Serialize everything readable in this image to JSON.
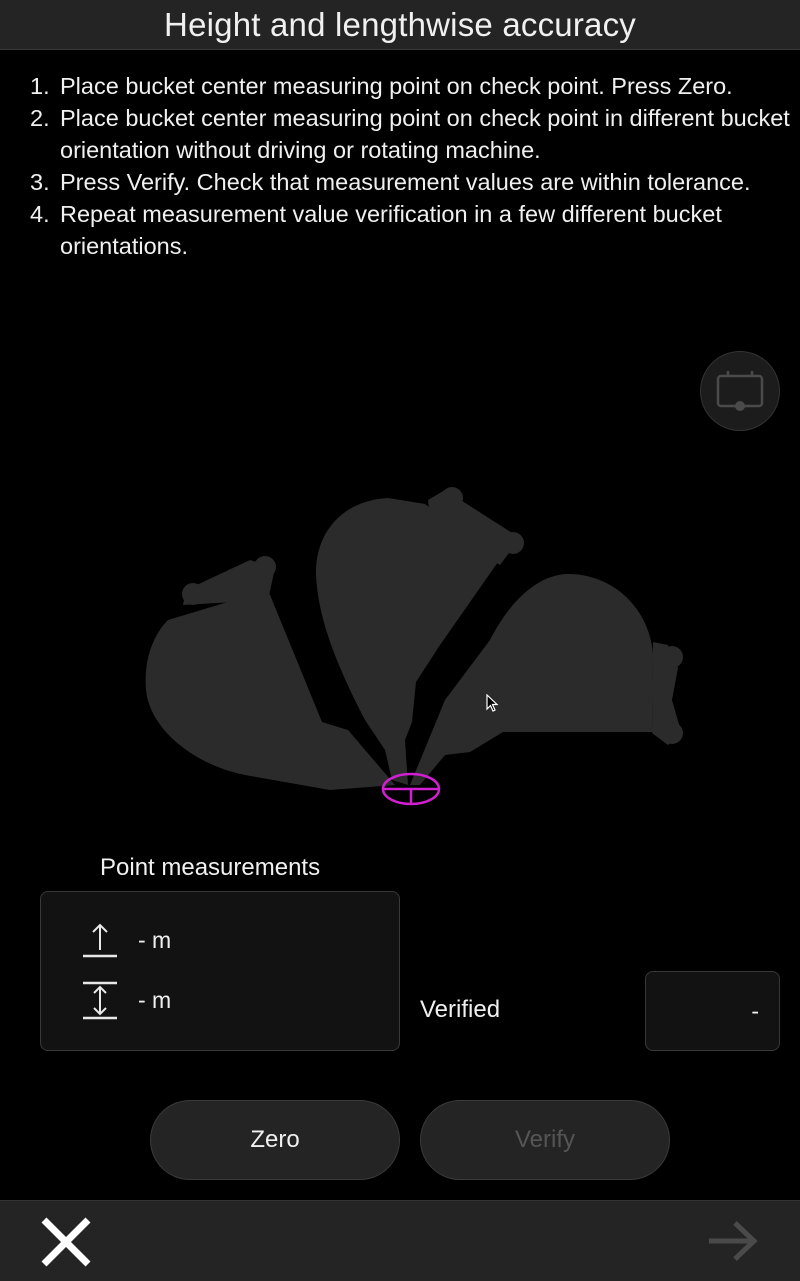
{
  "header": {
    "title": "Height and lengthwise accuracy"
  },
  "instructions": [
    {
      "num": "1.",
      "text": "Place bucket center measuring point on check point. Press Zero."
    },
    {
      "num": "2.",
      "text": "Place bucket center measuring point on check point in different bucket orientation without driving or rotating machine."
    },
    {
      "num": "3.",
      "text": "Press Verify. Check that measurement values are within tolerance."
    },
    {
      "num": "4.",
      "text": "Repeat measurement value verification in a few different bucket orientations."
    }
  ],
  "illustration": {
    "accent_color": "#d020d0",
    "bucket_color": "#2b2b2b"
  },
  "point_measurements": {
    "title": "Point measurements",
    "height_value": "- m",
    "length_value": "- m"
  },
  "verified": {
    "label": "Verified",
    "value": "-"
  },
  "buttons": {
    "zero": "Zero",
    "verify": "Verify"
  },
  "icons": {
    "machine": "machine-view-icon",
    "height": "height-arrow-icon",
    "length": "length-arrow-icon",
    "close": "close-icon",
    "next": "arrow-right-icon"
  }
}
